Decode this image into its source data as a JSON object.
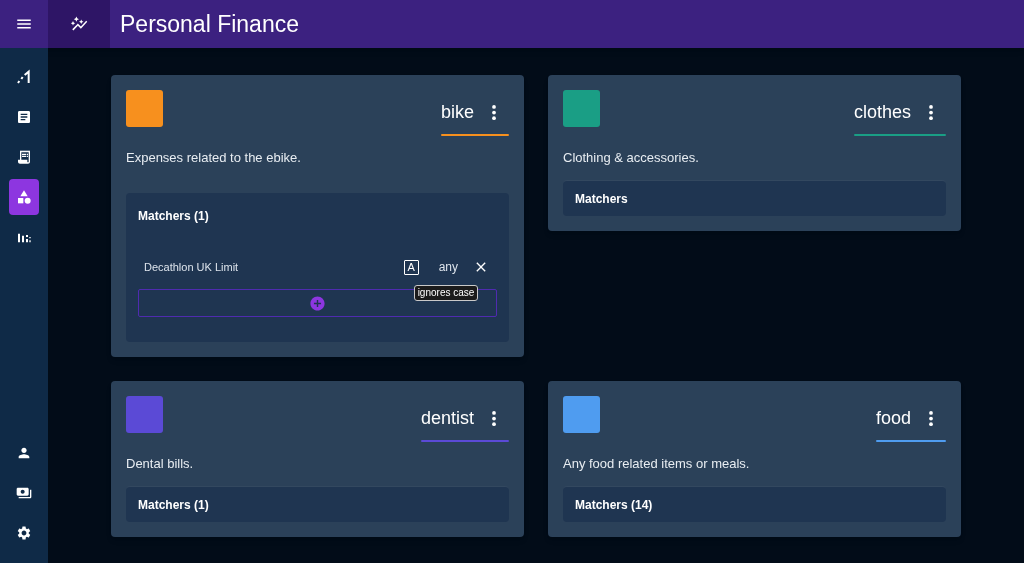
{
  "header": {
    "title": "Personal Finance"
  },
  "sidebar": {
    "items": [
      {
        "selected": false
      },
      {
        "selected": false
      },
      {
        "selected": false
      },
      {
        "selected": true
      },
      {
        "selected": false
      }
    ],
    "bottom_items": [
      {
        "selected": false
      },
      {
        "selected": false
      },
      {
        "selected": false
      }
    ]
  },
  "categories": [
    {
      "name": "bike",
      "color": "#f7901e",
      "description": "Expenses related to the ebike.",
      "matchers_title": "Matchers (1)",
      "expanded": true,
      "matchers": [
        {
          "text": "Decathlon UK Limit",
          "case_glyph": "A",
          "mode": "any",
          "tooltip": "ignores case"
        }
      ]
    },
    {
      "name": "clothes",
      "color": "#1a9e85",
      "description": "Clothing & accessories.",
      "matchers_title": "Matchers",
      "expanded": false
    },
    {
      "name": "dentist",
      "color": "#5b4ad6",
      "description": "Dental bills.",
      "matchers_title": "Matchers (1)",
      "expanded": false
    },
    {
      "name": "food",
      "color": "#4f9cf0",
      "description": "Any food related items or meals.",
      "matchers_title": "Matchers (14)",
      "expanded": false
    }
  ]
}
